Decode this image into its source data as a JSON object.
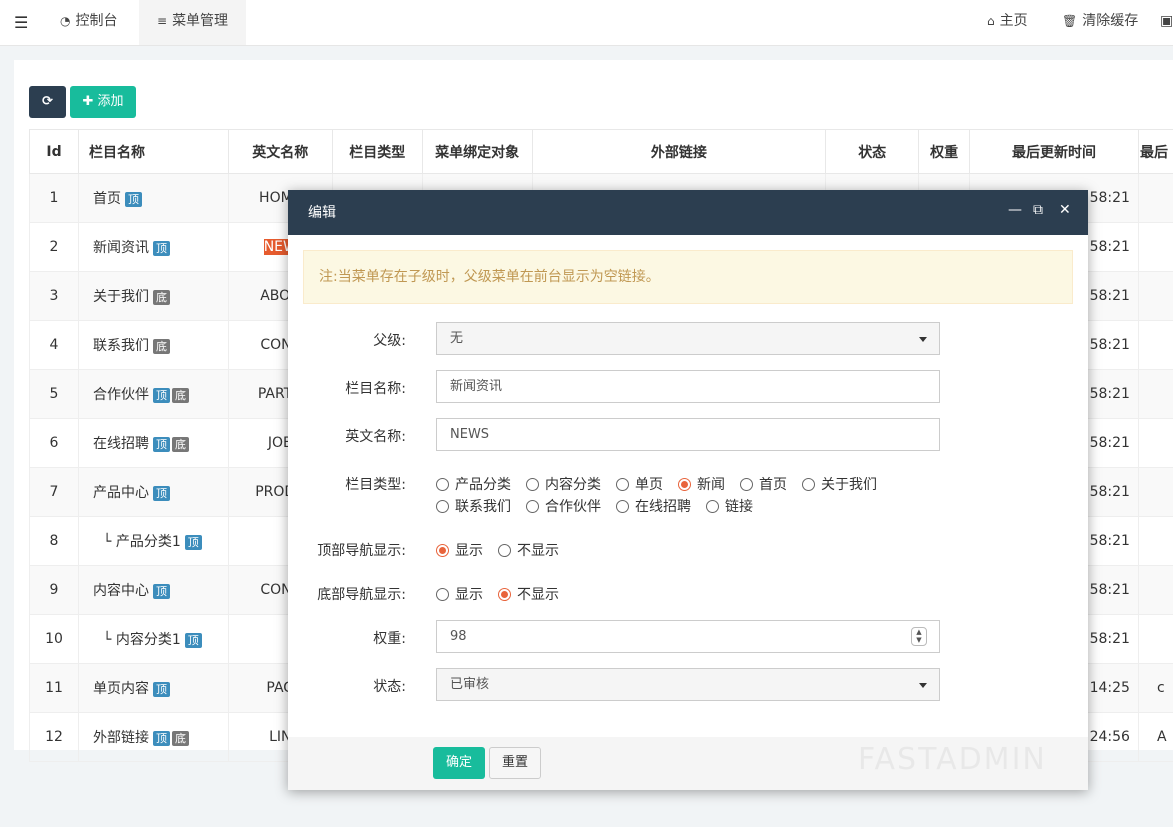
{
  "topbar": {
    "tabs": [
      {
        "label": "控制台",
        "icon": "dashboard-icon"
      },
      {
        "label": "菜单管理",
        "icon": "list-icon"
      }
    ],
    "home_label": "主页",
    "clear_cache_label": "清除缓存"
  },
  "toolbar": {
    "add_label": "添加"
  },
  "table": {
    "headers": [
      "Id",
      "栏目名称",
      "英文名称",
      "栏目类型",
      "菜单绑定对象",
      "外部链接",
      "状态",
      "权重",
      "最后更新时间",
      "最后"
    ],
    "rows": [
      {
        "id": "1",
        "name": "首页",
        "en": "HOME",
        "time": "58:21",
        "extra": ""
      },
      {
        "id": "2",
        "name": "新闻资讯",
        "en": "NEW",
        "time": "58:21",
        "extra": ""
      },
      {
        "id": "3",
        "name": "关于我们",
        "en": "ABOU",
        "time": "58:21",
        "extra": ""
      },
      {
        "id": "4",
        "name": "联系我们",
        "en": "CONT",
        "time": "58:21",
        "extra": ""
      },
      {
        "id": "5",
        "name": "合作伙伴",
        "en": "PARTN",
        "time": "58:21",
        "extra": ""
      },
      {
        "id": "6",
        "name": "在线招聘",
        "en": "JOB",
        "time": "58:21",
        "extra": ""
      },
      {
        "id": "7",
        "name": "产品中心",
        "en": "PRODU",
        "time": "58:21",
        "extra": ""
      },
      {
        "id": "8",
        "name": "└ 产品分类1",
        "en": "",
        "time": "58:21",
        "extra": ""
      },
      {
        "id": "9",
        "name": "内容中心",
        "en": "CONT",
        "time": "58:21",
        "extra": ""
      },
      {
        "id": "10",
        "name": "└ 内容分类1",
        "en": "",
        "time": "58:21",
        "extra": ""
      },
      {
        "id": "11",
        "name": "单页内容",
        "en": "PAG",
        "time": "14:25",
        "extra": "c"
      },
      {
        "id": "12",
        "name": "外部链接",
        "en": "LIN",
        "time": "24:56",
        "extra": "A"
      }
    ],
    "badge_top": "顶",
    "badge_bottom": "底"
  },
  "dialog": {
    "title": "编辑",
    "notice": "注:当菜单存在子级时，父级菜单在前台显示为空链接。",
    "labels": {
      "parent": "父级:",
      "name": "栏目名称:",
      "en_name": "英文名称:",
      "type": "栏目类型:",
      "top_nav": "顶部导航显示:",
      "bottom_nav": "底部导航显示:",
      "weight": "权重:",
      "status": "状态:"
    },
    "values": {
      "parent": "无",
      "name": "新闻资讯",
      "en_name": "NEWS",
      "weight": "98",
      "status": "已审核"
    },
    "type_options": [
      "产品分类",
      "内容分类",
      "单页",
      "新闻",
      "首页",
      "关于我们",
      "联系我们",
      "合作伙伴",
      "在线招聘",
      "链接"
    ],
    "type_selected": "新闻",
    "nav_options": [
      "显示",
      "不显示"
    ],
    "top_nav_selected": "显示",
    "bottom_nav_selected": "不显示",
    "ok_label": "确定",
    "reset_label": "重置",
    "watermark": "FASTADMIN"
  },
  "colors": {
    "accent": "#18bc9c",
    "header": "#2c3e50",
    "radio": "#e8643c",
    "badge_top": "#3c8dbc"
  }
}
